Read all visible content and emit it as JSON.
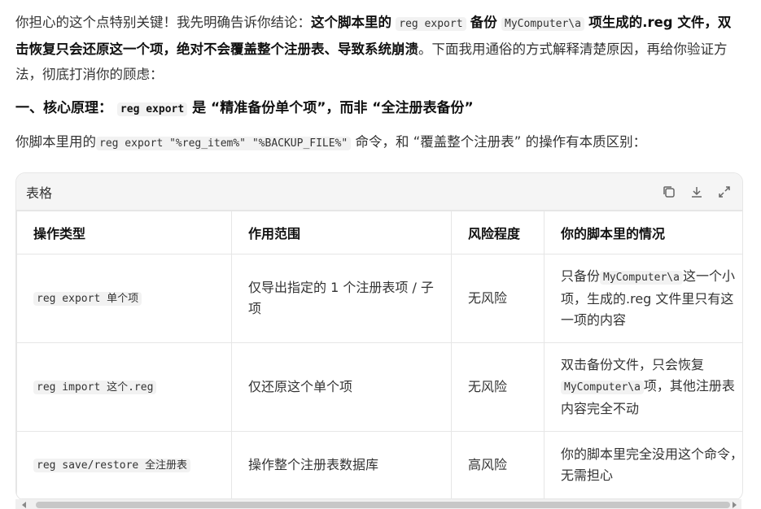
{
  "intro": {
    "t1": "你担心的这个点特别关键！我先明确告诉你结论：",
    "b1": "这个脚本里的",
    "c1": "reg export",
    "b2": "备份",
    "c2": "MyComputer\\a",
    "b3": "项生成的.reg 文件，双击恢复只会还原这一个项，绝对不会覆盖整个注册表、导致系统崩溃",
    "t2": "。下面我用通俗的方式解释清楚原因，再给你验证方法，彻底打消你的顾虑："
  },
  "section": {
    "h_prefix": "一、核心原理：",
    "h_code": "reg export",
    "h_suffix": "是 “精准备份单个项”，而非 “全注册表备份”"
  },
  "line": {
    "t1": "你脚本里用的",
    "code": "reg export \"%reg_item%\" \"%BACKUP_FILE%\"",
    "t2": "命令，和 “覆盖整个注册表” 的操作有本质区别："
  },
  "table": {
    "title": "表格",
    "headers": [
      "操作类型",
      "作用范围",
      "风险程度",
      "你的脚本里的情况"
    ],
    "rows": [
      {
        "op_code": "reg export 单个项",
        "scope": "仅导出指定的 1 个注册表项 / 子项",
        "risk": "无风险",
        "note_a": "只备份",
        "note_code": "MyComputer\\a",
        "note_b": "这一个小项，生成的.reg 文件里只有这一项的内容"
      },
      {
        "op_code": "reg import 这个.reg",
        "scope": "仅还原这个单个项",
        "risk": "无风险",
        "note_a": "双击备份文件，只会恢复",
        "note_code": "MyComputer\\a",
        "note_b": "项，其他注册表内容完全不动"
      },
      {
        "op_code": "reg save/restore 全注册表",
        "scope": "操作整个注册表数据库",
        "risk": "高风险",
        "note_a": "你的脚本里完全没用这个命令，无需担心",
        "note_code": "",
        "note_b": ""
      }
    ]
  },
  "icons": [
    "copy-icon",
    "download-icon",
    "expand-icon"
  ]
}
